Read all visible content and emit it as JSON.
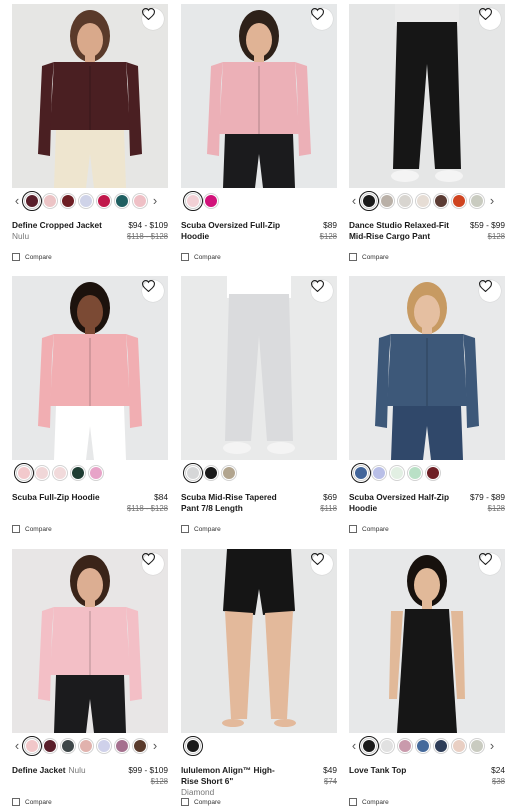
{
  "products": [
    {
      "name": "Define Cropped Jacket",
      "sub": "Nulu",
      "price": "$94 - $109",
      "was": "$118 - $128",
      "compare": "Compare",
      "swatches": [
        "#5a1f2b",
        "#ecc4c6",
        "#6e1f25",
        "#cfd3e8",
        "#c0174a",
        "#1f5f61",
        "#efc0c6"
      ],
      "selected": 0,
      "arrows": true,
      "photo": {
        "bg": "#e6e6e4",
        "top": "#4a1f22",
        "bottom": "#eee5cf",
        "skin": "#d9a98b",
        "hair": "#5a3a2a",
        "style": "jacket"
      }
    },
    {
      "name": "Scuba Oversized Full-Zip Hoodie",
      "sub": "",
      "price": "$89",
      "was": "$128",
      "compare": "Compare",
      "swatches": [
        "#f2d0d5",
        "#d1127a"
      ],
      "selected": 0,
      "arrows": false,
      "photo": {
        "bg": "#e6e8e9",
        "top": "#ecb0b7",
        "bottom": "#1b1b1d",
        "skin": "#e0b395",
        "hair": "#2e2119",
        "style": "hoodie"
      }
    },
    {
      "name": "Dance Studio Relaxed-Fit Mid-Rise Cargo Pant",
      "sub": "",
      "price": "$59 - $99",
      "was": "$128",
      "compare": "Compare",
      "swatches": [
        "#1a1a1a",
        "#b9b0a7",
        "#d8d5d0",
        "#e6ddd5",
        "#5b3b33",
        "#cf4420",
        "#c9cbc0"
      ],
      "selected": 0,
      "arrows": true,
      "photo": {
        "bg": "#e5e6e6",
        "top": "#eaeaea",
        "bottom": "#161616",
        "skin": "#ddb89c",
        "hair": "#2e2119",
        "style": "pants"
      }
    },
    {
      "name": "Scuba Full-Zip Hoodie",
      "sub": "",
      "price": "$84",
      "was": "$118 - $128",
      "compare": "Compare",
      "swatches": [
        "#f2c9cc",
        "#f0d7d8",
        "#f1dadb",
        "#1f3d33",
        "#e7a4c8"
      ],
      "selected": 0,
      "arrows": false,
      "photo": {
        "bg": "#e7e8e9",
        "top": "#f1aeb2",
        "bottom": "#ffffff",
        "skin": "#7b4a34",
        "hair": "#1c120d",
        "style": "hoodie"
      }
    },
    {
      "name": "Scuba Mid-Rise Tapered Pant 7/8 Length",
      "sub": "",
      "price": "$69",
      "was": "$118",
      "compare": "Compare",
      "swatches": [
        "#d6d7d8",
        "#1a1a1a",
        "#b2a58f"
      ],
      "selected": 0,
      "arrows": false,
      "photo": {
        "bg": "#e9eaea",
        "top": "#ffffff",
        "bottom": "#dadbdd",
        "skin": "#d9b296",
        "hair": "#2e2119",
        "style": "pants"
      }
    },
    {
      "name": "Scuba Oversized Half-Zip Hoodie",
      "sub": "",
      "price": "$79 - $89",
      "was": "$128",
      "compare": "Compare",
      "swatches": [
        "#42659a",
        "#b9bfe7",
        "#e2efe3",
        "#b9e0c6",
        "#6e1f25"
      ],
      "selected": 0,
      "arrows": false,
      "photo": {
        "bg": "#e8e9ea",
        "top": "#3d5879",
        "bottom": "#30486a",
        "skin": "#e5bfa1",
        "hair": "#c79a62",
        "style": "hoodie"
      }
    },
    {
      "name": "Define Jacket",
      "sub": "Nulu",
      "price": "$99 - $109",
      "was": "$128",
      "compare": "Compare",
      "swatches": [
        "#f1c7c9",
        "#5a1f2b",
        "#3e4648",
        "#e1b2ad",
        "#cfd1ea",
        "#a5708e",
        "#5a3b2c"
      ],
      "selected": 0,
      "arrows": true,
      "photo": {
        "bg": "#e8e6e6",
        "top": "#f3bfc6",
        "bottom": "#1b1b1d",
        "skin": "#dcae92",
        "hair": "#3a2419",
        "style": "jacket"
      }
    },
    {
      "name": "lululemon Align™ High-Rise Short 6\"",
      "sub": "Diamond",
      "price": "$49",
      "was": "$74",
      "compare": "Compare",
      "swatches": [
        "#1a1a1a"
      ],
      "selected": 0,
      "arrows": false,
      "photo": {
        "bg": "#e6e7e7",
        "top": "#e6e7e7",
        "bottom": "#151515",
        "skin": "#e3b99b",
        "hair": "#e6e7e7",
        "style": "shorts"
      }
    },
    {
      "name": "Love Tank Top",
      "sub": "",
      "price": "$24",
      "was": "$38",
      "compare": "Compare",
      "swatches": [
        "#1a1a1a",
        "#e1e1e1",
        "#c99aac",
        "#44699b",
        "#2e3d58",
        "#e9cfc3",
        "#c9cbc0"
      ],
      "selected": 0,
      "arrows": true,
      "photo": {
        "bg": "#e7e8e9",
        "top": "#161616",
        "bottom": "#161616",
        "skin": "#e1b999",
        "hair": "#17110d",
        "style": "tank"
      }
    }
  ]
}
